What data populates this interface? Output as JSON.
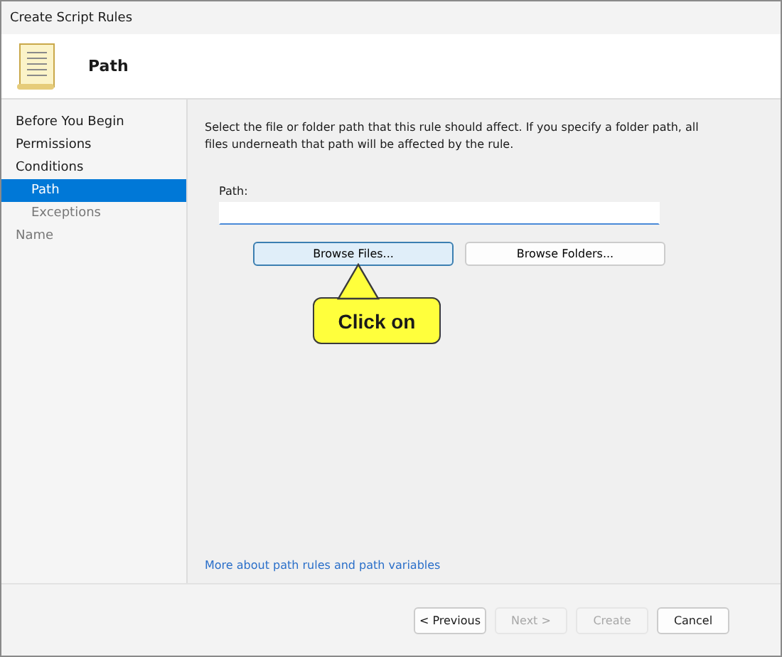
{
  "window": {
    "title": "Create Script Rules"
  },
  "header": {
    "title": "Path"
  },
  "sidebar": {
    "items": [
      {
        "label": "Before You Begin",
        "selected": false,
        "disabled": false
      },
      {
        "label": "Permissions",
        "selected": false,
        "disabled": false
      },
      {
        "label": "Conditions",
        "selected": false,
        "disabled": false,
        "children": [
          {
            "label": "Path",
            "selected": true,
            "disabled": false
          },
          {
            "label": "Exceptions",
            "selected": false,
            "disabled": true
          }
        ]
      },
      {
        "label": "Name",
        "selected": false,
        "disabled": true
      }
    ]
  },
  "content": {
    "description": "Select the file or folder path that this rule should affect. If you specify a folder path, all files underneath that path will be affected by the rule.",
    "path_label": "Path:",
    "browse_buttons": [
      {
        "label": "Browse Files...",
        "hovered": true
      },
      {
        "label": "Browse Folders...",
        "hovered": false
      }
    ],
    "callout": "Click on",
    "help_link": "More about path rules and path variables"
  },
  "footer": {
    "buttons": [
      {
        "label": "< Previous",
        "disabled": false
      },
      {
        "label": "Next >",
        "disabled": true
      },
      {
        "label": "Create",
        "disabled": true
      },
      {
        "label": "Cancel",
        "disabled": false
      }
    ]
  }
}
